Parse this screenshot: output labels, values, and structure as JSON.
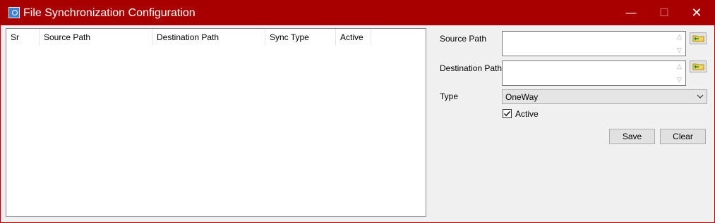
{
  "window": {
    "title": "File Synchronization Configuration",
    "controls": {
      "minimize": "—",
      "maximize": "☐",
      "close": "✕"
    },
    "title_bar_color": "#a80000"
  },
  "list": {
    "columns": [
      "Sr",
      "Source Path",
      "Destination Path",
      "Sync Type",
      "Active"
    ],
    "rows": []
  },
  "form": {
    "source_path": {
      "label": "Source Path",
      "value": ""
    },
    "destination_path": {
      "label": "Destination Path",
      "value": ""
    },
    "type": {
      "label": "Type",
      "value": "OneWay"
    },
    "active": {
      "label": "Active",
      "checked": true
    },
    "save_label": "Save",
    "clear_label": "Clear"
  },
  "icons": {
    "browse": "folder-icon",
    "app": "app-icon"
  }
}
